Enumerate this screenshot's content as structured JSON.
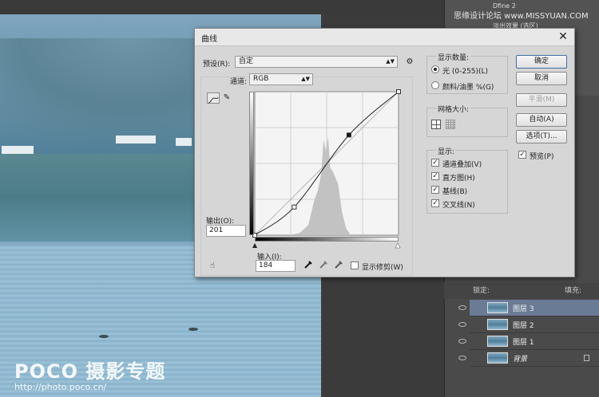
{
  "dialog": {
    "title": "曲线",
    "preset_label": "预设(R):",
    "preset_value": "自定",
    "channel_label": "通道:",
    "channel_value": "RGB",
    "output_label": "输出(O):",
    "output_value": "201",
    "input_label": "输入(I):",
    "input_value": "184",
    "show_clipping_label": "显示修剪(W)",
    "show_amount": {
      "title": "显示数量:",
      "light_label": "光 (0-255)(L)",
      "pigment_label": "颜料/油墨 %(G)"
    },
    "grid_size": {
      "title": "网格大小:"
    },
    "show": {
      "title": "显示:",
      "items": [
        {
          "label": "通道叠加(V)",
          "checked": true
        },
        {
          "label": "直方图(H)",
          "checked": true
        },
        {
          "label": "基线(B)",
          "checked": true
        },
        {
          "label": "交叉线(N)",
          "checked": true
        }
      ]
    },
    "buttons": {
      "ok": "确定",
      "cancel": "取消",
      "smooth": "平滑(M)",
      "auto": "自动(A)",
      "options": "选项(T)..."
    },
    "preview_label": "预览(P)"
  },
  "layers_panel": {
    "lock_label": "锁定:",
    "fill_label": "填充:",
    "layers": [
      {
        "name": "图层 3",
        "selected": true
      },
      {
        "name": "图层 2",
        "selected": false
      },
      {
        "name": "图层 1",
        "selected": false
      },
      {
        "name": "背景",
        "selected": false
      }
    ]
  },
  "actions_panel": {
    "rows": [
      "Dfine 2",
      "淡出效果 (选区)"
    ]
  },
  "top_watermark": "思缘设计论坛 www.MISSYUAN.COM",
  "photo_watermark": {
    "brand": "POCO 摄影专题",
    "url": "http://photo.poco.cn/"
  },
  "curve": {
    "points": [
      [
        0,
        0
      ],
      [
        70,
        50
      ],
      [
        167,
        178
      ],
      [
        255,
        255
      ]
    ],
    "histogram_color": "#c2c2c2"
  }
}
